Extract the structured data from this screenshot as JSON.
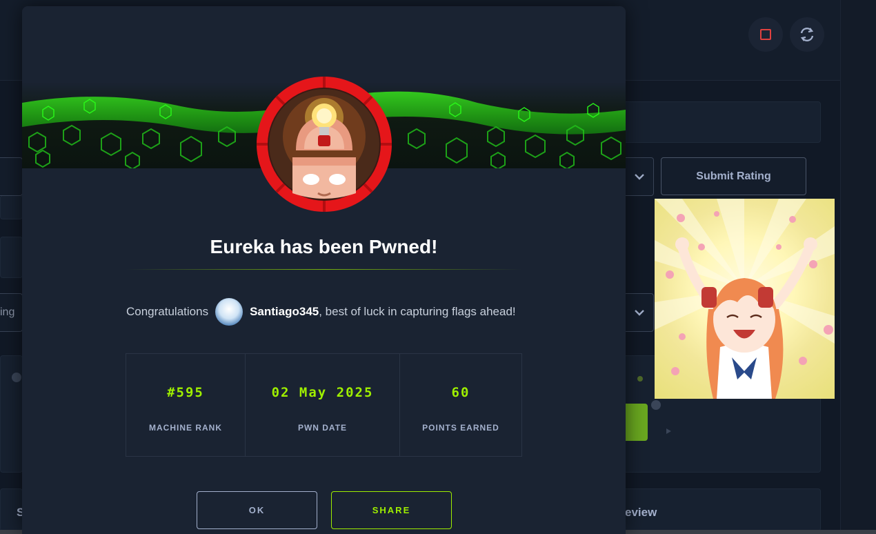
{
  "background": {
    "submit_rating_label": "Submit Rating",
    "left_select_text": "ing",
    "left_tab_text": "S",
    "review_text": "eview"
  },
  "modal": {
    "title": "Eureka has been Pwned!",
    "congrats_prefix": "Congratulations",
    "username": "Santiago345",
    "congrats_suffix": ", best of luck in capturing flags ahead!",
    "stats": [
      {
        "value": "#595",
        "label": "MACHINE RANK"
      },
      {
        "value": "02 May 2025",
        "label": "PWN DATE"
      },
      {
        "value": "60",
        "label": "POINTS EARNED"
      }
    ],
    "ok_label": "OK",
    "share_label": "SHARE"
  },
  "colors": {
    "accent": "#9fef00",
    "background": "#111926",
    "modal": "#1a2332",
    "badge_ring": "#e5161a"
  }
}
